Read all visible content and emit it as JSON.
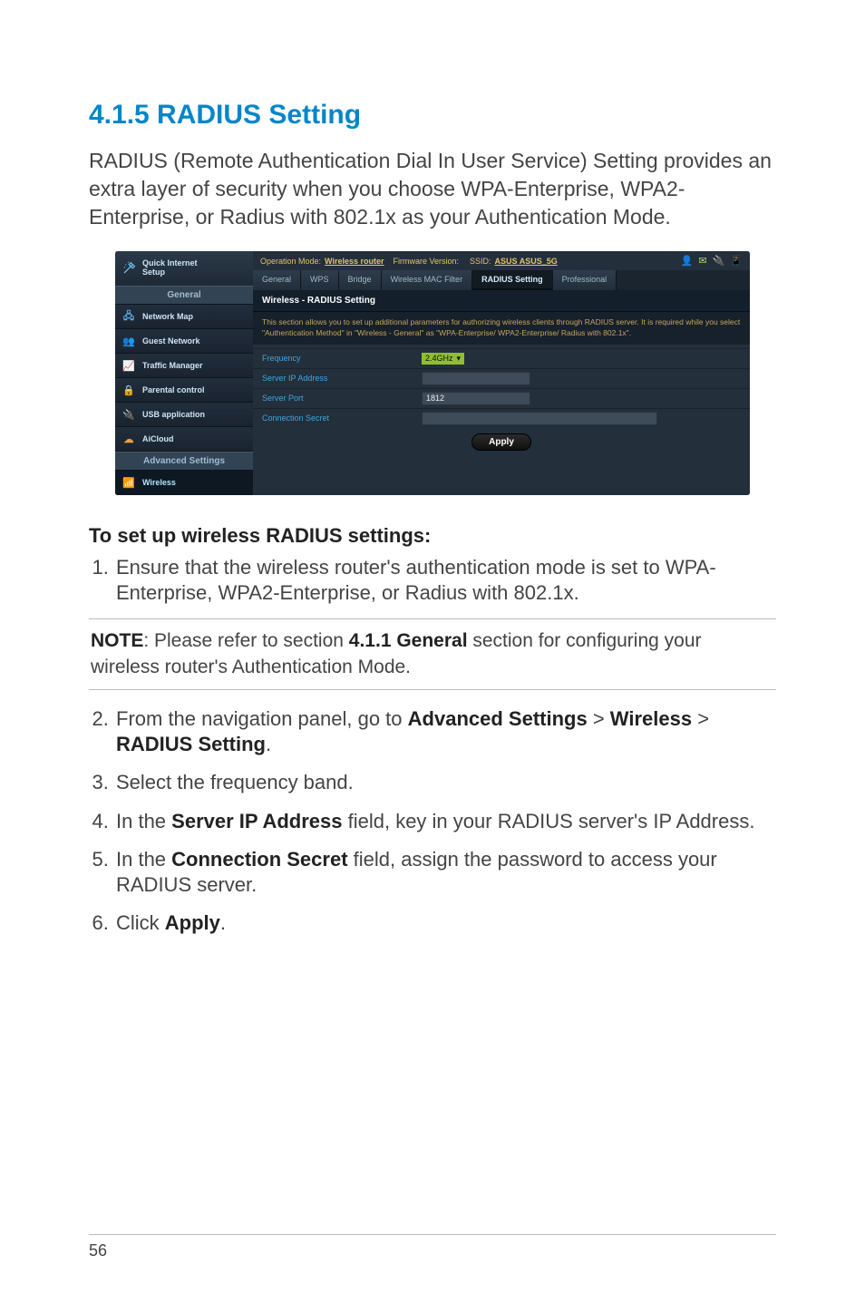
{
  "page_number": "56",
  "heading": "4.1.5 RADIUS Setting",
  "intro": "RADIUS (Remote Authentication Dial In User Service) Setting provides an extra layer of security when you choose WPA-Enterprise, WPA2-Enterprise, or Radius with 802.1x as your Authentication Mode.",
  "router": {
    "quick_setup_label": "Quick Internet\nSetup",
    "side_general_header": "General",
    "side_items": [
      {
        "icon": "🖧",
        "label": "Network Map",
        "color": "#5aa7e0"
      },
      {
        "icon": "👥",
        "label": "Guest Network",
        "color": "#d04e3a"
      },
      {
        "icon": "📈",
        "label": "Traffic Manager",
        "color": "#8fbe31"
      },
      {
        "icon": "🔒",
        "label": "Parental control",
        "color": "#e6a43a"
      },
      {
        "icon": "🔌",
        "label": "USB application",
        "color": "#d04e3a"
      },
      {
        "icon": "☁",
        "label": "AiCloud",
        "color": "#e6a43a"
      }
    ],
    "side_advanced_header": "Advanced Settings",
    "side_advanced_items": [
      {
        "icon": "📶",
        "label": "Wireless",
        "color": "#5aa7e0"
      }
    ],
    "status_mode_label": "Operation Mode:",
    "status_mode_value": "Wireless router",
    "status_fw_label": "Firmware Version:",
    "status_ssid_label": "SSID:",
    "status_ssid_value": "ASUS  ASUS_5G",
    "tabs": [
      "General",
      "WPS",
      "Bridge",
      "Wireless MAC Filter",
      "RADIUS Setting",
      "Professional"
    ],
    "active_tab_index": 4,
    "panel_title": "Wireless - RADIUS Setting",
    "panel_desc": "This section allows you to set up additional parameters for authorizing wireless clients through RADIUS server. It is required while you select \"Authentication Method\" in \"Wireless - General\" as \"WPA-Enterprise/ WPA2-Enterprise/ Radius with 802.1x\".",
    "rows": {
      "frequency": {
        "label": "Frequency",
        "value": "2.4GHz"
      },
      "server_ip": {
        "label": "Server IP Address",
        "value": ""
      },
      "server_port": {
        "label": "Server Port",
        "value": "1812"
      },
      "conn_secret": {
        "label": "Connection Secret",
        "value": ""
      }
    },
    "apply_label": "Apply"
  },
  "steps_title": "To set up wireless RADIUS settings:",
  "step1": "Ensure that the wireless router's authentication mode is set to WPA-Enterprise, WPA2-Enterprise, or Radius with 802.1x.",
  "note_label": "NOTE",
  "note_text_pre": ":  Please refer to section ",
  "note_bold": "4.1.1 General",
  "note_text_post": " section for configuring your wireless router's Authentication Mode.",
  "step2_pre": "From the navigation panel, go to ",
  "step2_b1": "Advanced Settings",
  "step2_mid1": " > ",
  "step2_b2": "Wireless",
  "step2_mid2": " > ",
  "step2_b3": "RADIUS Setting",
  "step2_post": ".",
  "step3": "Select the frequency band.",
  "step4_pre": "In the ",
  "step4_b": "Server IP Address",
  "step4_post": " field, key in your RADIUS server's IP Address.",
  "step5_pre": "In the ",
  "step5_b": "Connection Secret",
  "step5_post": " field, assign the password to access your RADIUS server.",
  "step6_pre": "Click ",
  "step6_b": "Apply",
  "step6_post": "."
}
